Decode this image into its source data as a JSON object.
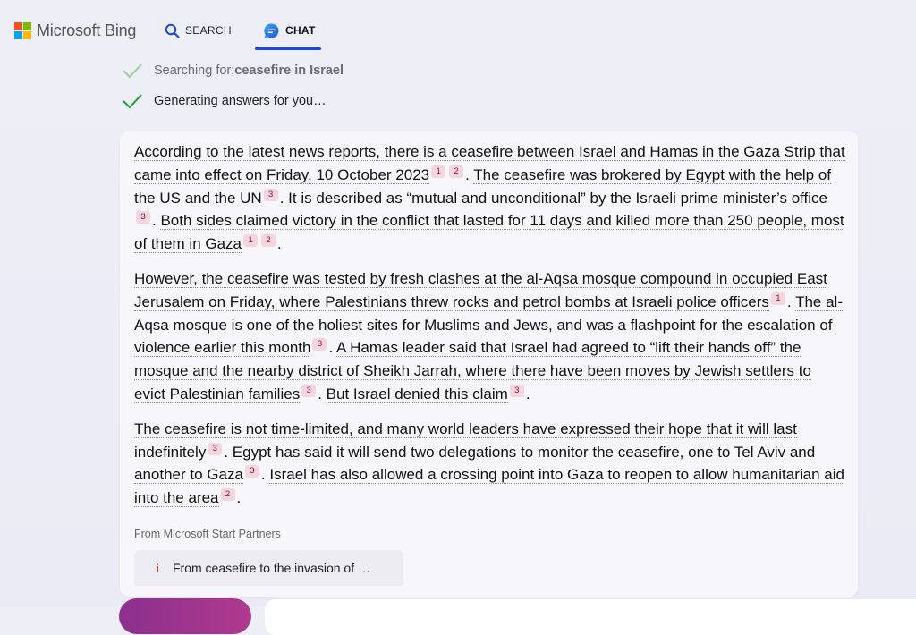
{
  "header": {
    "brand": "Microsoft Bing",
    "logo_colors": [
      "#f25022",
      "#7fba00",
      "#00a4ef",
      "#ffb900"
    ],
    "nav": {
      "search_label": "SEARCH",
      "chat_label": "CHAT"
    },
    "accent_color": "#174ae4"
  },
  "status": {
    "searching_prefix": "Searching for: ",
    "searching_query": "ceasefire in Israel",
    "generating": "Generating answers for you…"
  },
  "answer": {
    "p1": {
      "s1": "According to the latest news reports, there is a ceasefire between Israel and Hamas in the Gaza Strip that came into effect on Friday, 10 October 2023",
      "s1_cites": [
        "1",
        "2"
      ],
      "s2": "The ceasefire was brokered by Egypt with the help of the US and the UN",
      "s2_cites": [
        "3"
      ],
      "s3": "It is described as “mutual and unconditional” by the Israeli prime minister’s office",
      "s3_cites": [
        "3"
      ],
      "s4": "Both sides claimed victory in the conflict that lasted for 11 days and killed more than 250 people, most of them in Gaza",
      "s4_cites": [
        "1",
        "2"
      ]
    },
    "p2": {
      "s1": "However, the ceasefire was tested by fresh clashes at the al-Aqsa mosque compound in occupied East Jerusalem on Friday, where Palestinians threw rocks and petrol bombs at Israeli police officers",
      "s1_cites": [
        "1"
      ],
      "s2": "The al-Aqsa mosque is one of the holiest sites for Muslims and Jews, and was a flashpoint for the escalation of violence earlier this month",
      "s2_cites": [
        "3"
      ],
      "s3": "A Hamas leader said that Israel had agreed to “lift their hands off” the mosque and the nearby district of Sheikh Jarrah, where there have been moves by Jewish settlers to evict Palestinian families",
      "s3_cites": [
        "3"
      ],
      "s4": "But Israel denied this claim",
      "s4_cites": [
        "3"
      ]
    },
    "p3": {
      "s1": "The ceasefire is not time-limited, and many world leaders have expressed their hope that it will last indefinitely",
      "s1_cites": [
        "3"
      ],
      "s2": "Egypt has said it will send two delegations to monitor the ceasefire, one to Tel Aviv and another to Gaza",
      "s2_cites": [
        "3"
      ],
      "s3": "Israel has also allowed a crossing point into Gaza to reopen to allow humanitarian aid into the area",
      "s3_cites": [
        "2"
      ]
    },
    "period": ".",
    "partners_label": "From Microsoft Start Partners",
    "source_card": {
      "icon": "info-icon",
      "title": "From ceasefire to the invasion of …"
    }
  }
}
